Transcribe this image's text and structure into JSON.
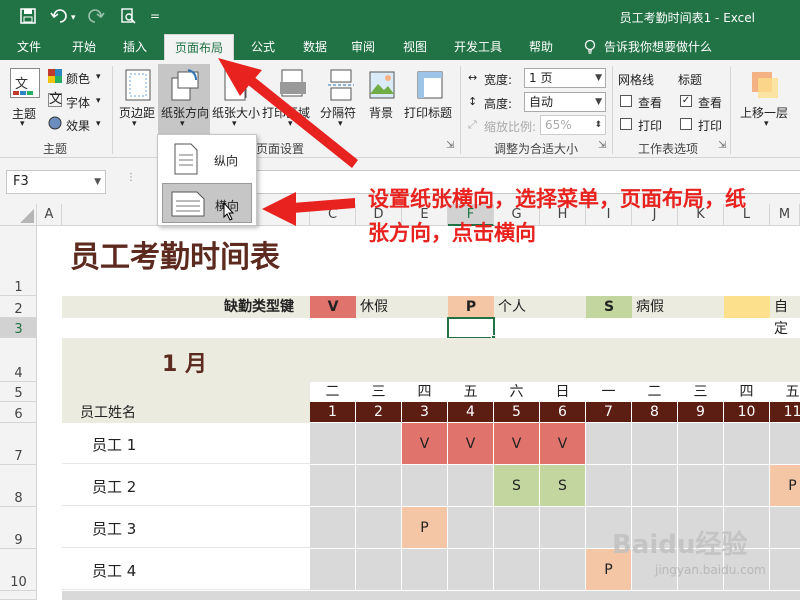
{
  "window": {
    "title": "员工考勤时间表1  -  Excel"
  },
  "quick_access": {
    "save_icon": "save-icon",
    "undo_icon": "undo-icon",
    "redo_icon": "redo-icon",
    "preview_icon": "print-preview-icon",
    "more": "="
  },
  "tabs": [
    "文件",
    "开始",
    "插入",
    "页面布局",
    "公式",
    "数据",
    "审阅",
    "视图",
    "开发工具",
    "帮助"
  ],
  "active_tab": "页面布局",
  "tell_me": "告诉我你想要做什么",
  "ribbon": {
    "theme": {
      "btn": "主题",
      "colors": "颜色",
      "fonts": "字体",
      "effects": "效果",
      "group": "主题"
    },
    "page_setup": {
      "margins": "页边距",
      "orientation": "纸张方向",
      "size": "纸张大小",
      "print_area": "打印区域",
      "breaks": "分隔符",
      "background": "背景",
      "print_titles": "打印标题",
      "group": "页面设置"
    },
    "scale": {
      "width_label": "宽度:",
      "width_val": "1 页",
      "height_label": "高度:",
      "height_val": "自动",
      "scale_label": "缩放比例:",
      "scale_val": "65%",
      "group": "调整为合适大小"
    },
    "sheet_options": {
      "gridlines": "网格线",
      "headings": "标题",
      "view": "查看",
      "print": "打印",
      "group": "工作表选项"
    },
    "arrange": {
      "bring_forward": "上移一层"
    }
  },
  "orientation_menu": {
    "portrait": "纵向",
    "landscape": "横向"
  },
  "name_box": "F3",
  "columns": [
    "A",
    "B",
    "C",
    "D",
    "E",
    "F",
    "G",
    "H",
    "I",
    "J",
    "K",
    "L",
    "M"
  ],
  "rows": [
    "1",
    "2",
    "3",
    "4",
    "5",
    "6",
    "7",
    "8",
    "9",
    "10"
  ],
  "sheet": {
    "title": "员工考勤时间表",
    "key_label": "缺勤类型键",
    "keys": [
      {
        "code": "V",
        "label": "休假",
        "color": "#e0736b"
      },
      {
        "code": "P",
        "label": "个人",
        "color": "#f4c6a5"
      },
      {
        "code": "S",
        "label": "病假",
        "color": "#c4d6a0"
      },
      {
        "code": "",
        "label": "自定",
        "color": "#fde08c"
      }
    ],
    "month": "1 月",
    "employee_header": "员工姓名",
    "weekdays": [
      "二",
      "三",
      "四",
      "五",
      "六",
      "日",
      "一",
      "二",
      "三",
      "四",
      "五"
    ],
    "days": [
      "1",
      "2",
      "3",
      "4",
      "5",
      "6",
      "7",
      "8",
      "9",
      "10",
      "11"
    ],
    "employees": [
      {
        "name": "员工 1",
        "marks": [
          "",
          "",
          "V",
          "V",
          "V",
          "V",
          "",
          "",
          "",
          "",
          ""
        ]
      },
      {
        "name": "员工 2",
        "marks": [
          "",
          "",
          "",
          "",
          "S",
          "S",
          "",
          "",
          "",
          "",
          "P"
        ]
      },
      {
        "name": "员工 3",
        "marks": [
          "",
          "",
          "P",
          "",
          "",
          "",
          "",
          "",
          "",
          "",
          ""
        ]
      },
      {
        "name": "员工 4",
        "marks": [
          "",
          "",
          "",
          "",
          "",
          "",
          "P",
          "",
          "",
          "",
          ""
        ]
      }
    ]
  },
  "annotation": "设置纸张横向，选择菜单，页面布局，纸张方向，点击横向",
  "watermark": {
    "brand": "Baidu经验",
    "url": "jingyan.baidu.com"
  }
}
